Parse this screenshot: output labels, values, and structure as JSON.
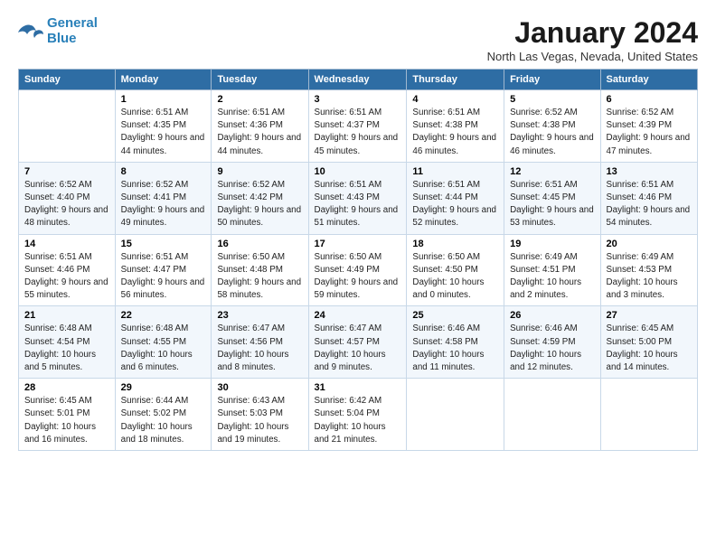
{
  "logo": {
    "line1": "General",
    "line2": "Blue"
  },
  "title": "January 2024",
  "subtitle": "North Las Vegas, Nevada, United States",
  "weekdays": [
    "Sunday",
    "Monday",
    "Tuesday",
    "Wednesday",
    "Thursday",
    "Friday",
    "Saturday"
  ],
  "rows": [
    [
      {
        "num": "",
        "detail": ""
      },
      {
        "num": "1",
        "detail": "Sunrise: 6:51 AM\nSunset: 4:35 PM\nDaylight: 9 hours\nand 44 minutes."
      },
      {
        "num": "2",
        "detail": "Sunrise: 6:51 AM\nSunset: 4:36 PM\nDaylight: 9 hours\nand 44 minutes."
      },
      {
        "num": "3",
        "detail": "Sunrise: 6:51 AM\nSunset: 4:37 PM\nDaylight: 9 hours\nand 45 minutes."
      },
      {
        "num": "4",
        "detail": "Sunrise: 6:51 AM\nSunset: 4:38 PM\nDaylight: 9 hours\nand 46 minutes."
      },
      {
        "num": "5",
        "detail": "Sunrise: 6:52 AM\nSunset: 4:38 PM\nDaylight: 9 hours\nand 46 minutes."
      },
      {
        "num": "6",
        "detail": "Sunrise: 6:52 AM\nSunset: 4:39 PM\nDaylight: 9 hours\nand 47 minutes."
      }
    ],
    [
      {
        "num": "7",
        "detail": "Sunrise: 6:52 AM\nSunset: 4:40 PM\nDaylight: 9 hours\nand 48 minutes."
      },
      {
        "num": "8",
        "detail": "Sunrise: 6:52 AM\nSunset: 4:41 PM\nDaylight: 9 hours\nand 49 minutes."
      },
      {
        "num": "9",
        "detail": "Sunrise: 6:52 AM\nSunset: 4:42 PM\nDaylight: 9 hours\nand 50 minutes."
      },
      {
        "num": "10",
        "detail": "Sunrise: 6:51 AM\nSunset: 4:43 PM\nDaylight: 9 hours\nand 51 minutes."
      },
      {
        "num": "11",
        "detail": "Sunrise: 6:51 AM\nSunset: 4:44 PM\nDaylight: 9 hours\nand 52 minutes."
      },
      {
        "num": "12",
        "detail": "Sunrise: 6:51 AM\nSunset: 4:45 PM\nDaylight: 9 hours\nand 53 minutes."
      },
      {
        "num": "13",
        "detail": "Sunrise: 6:51 AM\nSunset: 4:46 PM\nDaylight: 9 hours\nand 54 minutes."
      }
    ],
    [
      {
        "num": "14",
        "detail": "Sunrise: 6:51 AM\nSunset: 4:46 PM\nDaylight: 9 hours\nand 55 minutes."
      },
      {
        "num": "15",
        "detail": "Sunrise: 6:51 AM\nSunset: 4:47 PM\nDaylight: 9 hours\nand 56 minutes."
      },
      {
        "num": "16",
        "detail": "Sunrise: 6:50 AM\nSunset: 4:48 PM\nDaylight: 9 hours\nand 58 minutes."
      },
      {
        "num": "17",
        "detail": "Sunrise: 6:50 AM\nSunset: 4:49 PM\nDaylight: 9 hours\nand 59 minutes."
      },
      {
        "num": "18",
        "detail": "Sunrise: 6:50 AM\nSunset: 4:50 PM\nDaylight: 10 hours\nand 0 minutes."
      },
      {
        "num": "19",
        "detail": "Sunrise: 6:49 AM\nSunset: 4:51 PM\nDaylight: 10 hours\nand 2 minutes."
      },
      {
        "num": "20",
        "detail": "Sunrise: 6:49 AM\nSunset: 4:53 PM\nDaylight: 10 hours\nand 3 minutes."
      }
    ],
    [
      {
        "num": "21",
        "detail": "Sunrise: 6:48 AM\nSunset: 4:54 PM\nDaylight: 10 hours\nand 5 minutes."
      },
      {
        "num": "22",
        "detail": "Sunrise: 6:48 AM\nSunset: 4:55 PM\nDaylight: 10 hours\nand 6 minutes."
      },
      {
        "num": "23",
        "detail": "Sunrise: 6:47 AM\nSunset: 4:56 PM\nDaylight: 10 hours\nand 8 minutes."
      },
      {
        "num": "24",
        "detail": "Sunrise: 6:47 AM\nSunset: 4:57 PM\nDaylight: 10 hours\nand 9 minutes."
      },
      {
        "num": "25",
        "detail": "Sunrise: 6:46 AM\nSunset: 4:58 PM\nDaylight: 10 hours\nand 11 minutes."
      },
      {
        "num": "26",
        "detail": "Sunrise: 6:46 AM\nSunset: 4:59 PM\nDaylight: 10 hours\nand 12 minutes."
      },
      {
        "num": "27",
        "detail": "Sunrise: 6:45 AM\nSunset: 5:00 PM\nDaylight: 10 hours\nand 14 minutes."
      }
    ],
    [
      {
        "num": "28",
        "detail": "Sunrise: 6:45 AM\nSunset: 5:01 PM\nDaylight: 10 hours\nand 16 minutes."
      },
      {
        "num": "29",
        "detail": "Sunrise: 6:44 AM\nSunset: 5:02 PM\nDaylight: 10 hours\nand 18 minutes."
      },
      {
        "num": "30",
        "detail": "Sunrise: 6:43 AM\nSunset: 5:03 PM\nDaylight: 10 hours\nand 19 minutes."
      },
      {
        "num": "31",
        "detail": "Sunrise: 6:42 AM\nSunset: 5:04 PM\nDaylight: 10 hours\nand 21 minutes."
      },
      {
        "num": "",
        "detail": ""
      },
      {
        "num": "",
        "detail": ""
      },
      {
        "num": "",
        "detail": ""
      }
    ]
  ]
}
